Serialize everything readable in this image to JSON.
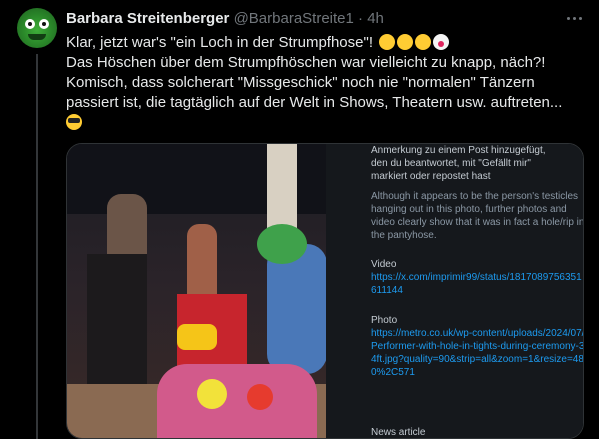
{
  "tweet": {
    "display_name": "Barbara Streitenberger",
    "handle": "@BarbaraStreite1",
    "separator": "·",
    "time": "4h",
    "lines": [
      "Klar, jetzt war's \"ein Loch in der Strumpfhose\"!",
      "Das Höschen über dem Strumpfhöschen war vielleicht zu knapp, näch?!",
      "Komisch, dass solcherart \"Missgeschick\" noch nie \"normalen\" Tänzern",
      "passiert ist, die tagtäglich auf der Welt in Shows, Theatern usw. auftreten..."
    ]
  },
  "note": {
    "header_1": "Anmerkung zu einem Post hinzugefügt,",
    "header_2": "den du beantwortet, mit \"Gefällt mir\"",
    "header_3": "markiert oder repostet hast",
    "body": "Although it appears to be the person's testicles hanging out in this photo, further photos and video clearly show that it was in fact a hole/rip in the pantyhose.",
    "video_label": "Video",
    "video_link": "https://x.com/imprimir99/status/1817089756351611144",
    "photo_label": "Photo",
    "photo_link": "https://metro.co.uk/wp-content/uploads/2024/07/Performer-with-hole-in-tights-during-ceremony-34ft.jpg?quality=90&strip=all&zoom=1&resize=480%2C571",
    "news_label": "News article"
  },
  "icons": {
    "avatar": "kermit-frog-avatar",
    "more": "more-dots-icon",
    "emojis": [
      "tears-of-joy-emoji",
      "rolling-laughing-emoji",
      "partying-face-emoji",
      "clown-face-emoji",
      "sunglasses-face-emoji"
    ]
  },
  "colors": {
    "background": "#000000",
    "text": "#e7e9ea",
    "muted": "#71767b",
    "link": "#1d9bf0",
    "note_bg": "#15181c"
  }
}
